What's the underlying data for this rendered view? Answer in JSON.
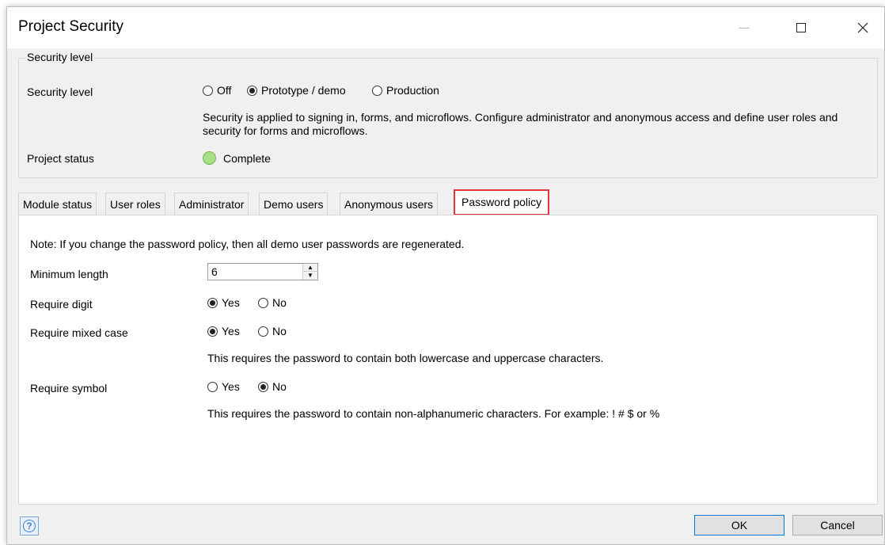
{
  "window": {
    "title": "Project Security"
  },
  "security_group": {
    "legend": "Security level",
    "security_level_label": "Security level",
    "options": [
      {
        "label": "Off",
        "selected": false
      },
      {
        "label": "Prototype / demo",
        "selected": true
      },
      {
        "label": "Production",
        "selected": false
      }
    ],
    "description": "Security is applied to signing in, forms, and microflows. Configure administrator and anonymous access and define user roles and security for forms and microflows.",
    "project_status_label": "Project status",
    "project_status_value": "Complete",
    "status_color": "#a8e08a"
  },
  "tabs": [
    {
      "label": "Module status"
    },
    {
      "label": "User roles"
    },
    {
      "label": "Administrator"
    },
    {
      "label": "Demo users"
    },
    {
      "label": "Anonymous users"
    },
    {
      "label": "Password policy",
      "active": true
    }
  ],
  "password_policy": {
    "note": "Note: If you change the password policy, then all demo user passwords are regenerated.",
    "min_length_label": "Minimum length",
    "min_length_value": "6",
    "require_digit_label": "Require digit",
    "require_digit": {
      "yes": "Yes",
      "no": "No",
      "selected": "Yes"
    },
    "require_mixed_case_label": "Require mixed case",
    "require_mixed_case": {
      "yes": "Yes",
      "no": "No",
      "selected": "Yes"
    },
    "mixed_case_help": "This requires the password to contain both lowercase and uppercase characters.",
    "require_symbol_label": "Require symbol",
    "require_symbol": {
      "yes": "Yes",
      "no": "No",
      "selected": "No"
    },
    "symbol_help": "This requires the password to contain non-alphanumeric characters. For example: ! # $ or %"
  },
  "footer": {
    "ok_label": "OK",
    "cancel_label": "Cancel"
  },
  "icons": {
    "help": "help-icon",
    "minimize": "minimize-icon",
    "maximize": "maximize-icon",
    "close": "close-icon"
  }
}
